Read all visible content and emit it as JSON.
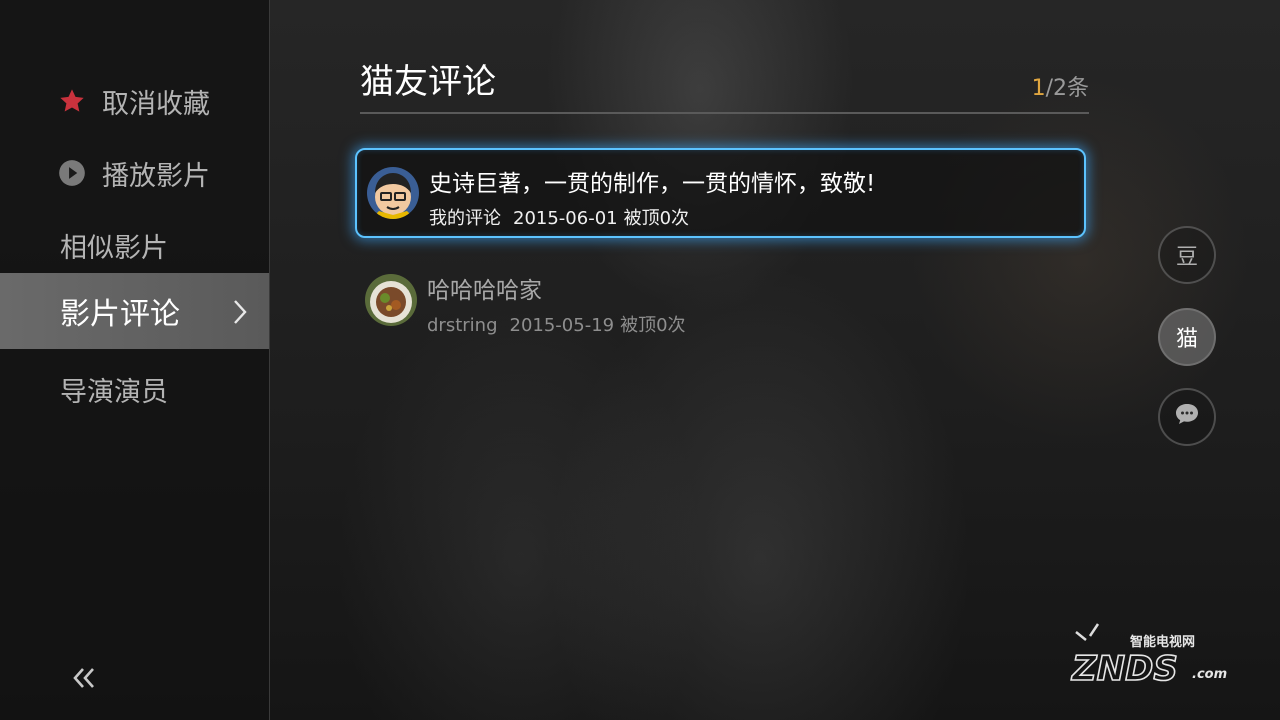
{
  "sidebar": {
    "items": [
      {
        "label": "取消收藏",
        "icon": "star-icon"
      },
      {
        "label": "播放影片",
        "icon": "play-icon"
      },
      {
        "label": "相似影片"
      },
      {
        "label": "影片评论",
        "active": true
      },
      {
        "label": "导演演员"
      }
    ],
    "collapse_icon": "double-chevron-left-icon"
  },
  "section": {
    "title": "猫友评论",
    "counter_current": "1",
    "counter_rest": "/2条"
  },
  "comments": [
    {
      "text": "史诗巨著，一贯的制作，一贯的情怀，致敬!",
      "author": "我的评论",
      "date": "2015-06-01",
      "likes": "被顶0次",
      "focused": true
    },
    {
      "text": "哈哈哈哈家",
      "author": "drstring",
      "date": "2015-05-19",
      "likes": "被顶0次"
    }
  ],
  "source_tabs": [
    {
      "label": "豆"
    },
    {
      "label": "猫",
      "active": true
    },
    {
      "label": "",
      "icon": "chat-bubble-icon"
    }
  ],
  "watermark": {
    "top": "智能电视网",
    "brand": "ZNDS",
    ".com": ".com"
  },
  "colors": {
    "accent_star": "#c9323d",
    "focus_border": "#5cc3ff",
    "counter_current": "#e0a640"
  }
}
